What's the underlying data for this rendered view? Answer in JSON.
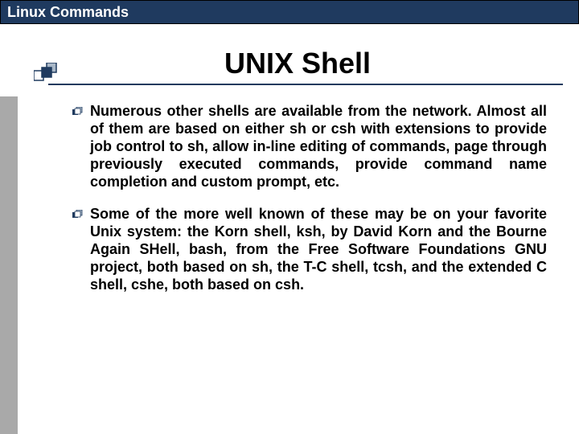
{
  "header": {
    "title": "Linux Commands"
  },
  "slide": {
    "title": "UNIX Shell",
    "bullets": [
      "Numerous other shells are available from the network. Almost all of them are based on either sh or csh with extensions to provide job control to sh, allow in-line editing of commands, page through previously executed commands, provide command name completion and custom prompt, etc.",
      "Some of the more well known of these may be on your favorite Unix system: the Korn shell, ksh, by David Korn and the Bourne Again SHell, bash, from the Free Software Foundations GNU project, both based on sh, the T-C shell, tcsh, and the extended C shell, cshe, both based on csh."
    ]
  }
}
